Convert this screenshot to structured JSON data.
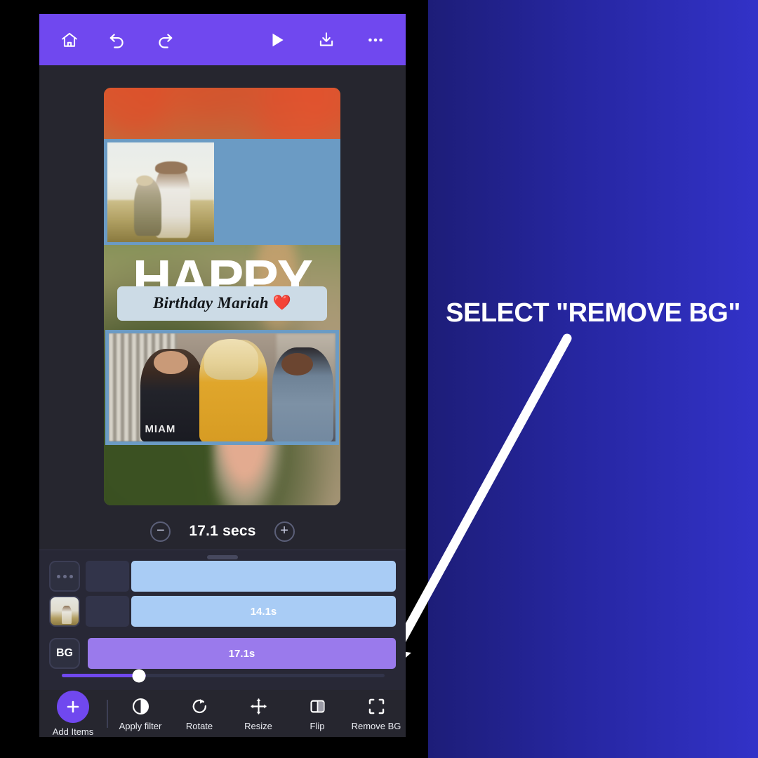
{
  "promo": {
    "headline": "SELECT \"REMOVE BG\"",
    "bg_from": "#1d1d78",
    "bg_to": "#3232c8",
    "arrow_color": "#ffffff"
  },
  "app": {
    "accent": "#7048ef",
    "surface": "#26262f",
    "topbar": {
      "left_actions": [
        {
          "name": "home-icon",
          "label": "Home"
        },
        {
          "name": "undo-icon",
          "label": "Undo"
        },
        {
          "name": "redo-icon",
          "label": "Redo"
        }
      ],
      "right_actions": [
        {
          "name": "play-icon",
          "label": "Play"
        },
        {
          "name": "download-icon",
          "label": "Download"
        },
        {
          "name": "more-icon",
          "label": "More"
        }
      ]
    },
    "canvas": {
      "headline": "HAPPY",
      "banner_text": "Birthday Mariah",
      "banner_heart": "❤️",
      "friends_shirt_text": "MIAM",
      "frame_color": "#6b9bc4",
      "banner_color": "#ccdbe6"
    },
    "duration": {
      "decrease_label": "−",
      "value": "17.1 secs",
      "increase_label": "+"
    },
    "timeline": {
      "tracks": [
        {
          "thumb": "dots-thumb",
          "label": "",
          "bar_color": "#a9ccf5",
          "type": "clip"
        },
        {
          "thumb": "photo-thumb",
          "label": "14.1s",
          "bar_color": "#a9ccf5",
          "type": "clip"
        },
        {
          "thumb": "BG",
          "label": "17.1s",
          "bar_color": "#9a7aec",
          "type": "background"
        }
      ],
      "scroll_percent": 26
    },
    "toolbar": [
      {
        "label": "Add Items",
        "icon": "plus-icon"
      },
      {
        "label": "Apply filter",
        "icon": "contrast-icon"
      },
      {
        "label": "Rotate",
        "icon": "rotate-icon"
      },
      {
        "label": "Resize",
        "icon": "resize-icon"
      },
      {
        "label": "Flip",
        "icon": "flip-icon"
      },
      {
        "label": "Remove BG",
        "icon": "remove-bg-icon"
      }
    ]
  }
}
